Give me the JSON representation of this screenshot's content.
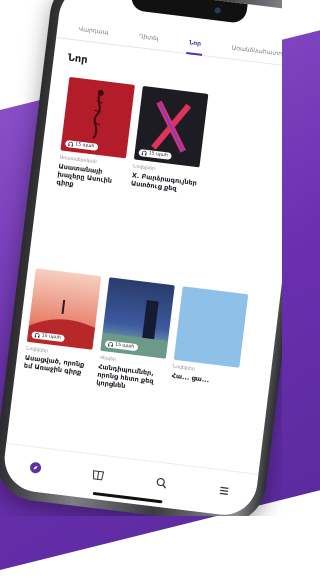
{
  "tabs": [
    {
      "label": "Վարդապ"
    },
    {
      "label": "Դիտել"
    },
    {
      "label": "Նոր"
    },
    {
      "label": "Առանձնահատուկ"
    }
  ],
  "active_tab_index": 2,
  "section": {
    "title": "Նոր"
  },
  "cards": [
    {
      "duration": "15 պահ",
      "genre": "Առասպելական",
      "title": "Ասատանայի խաչերը Ասուին գիրք",
      "cover_color": "#b31d2a"
    },
    {
      "duration": "15 պահ",
      "genre": "Նովելներ",
      "title": "X. Բարձրագույներ Աստծուց քեզ",
      "cover_color": "#1c1c22"
    },
    {
      "duration": "15 պահ",
      "genre": "Նովելներ",
      "title": "Ասացված, որոնք եմ Առաջին գիրք",
      "cover_color": "#f2b7a6"
    },
    {
      "duration": "15 պահ",
      "genre": "Վեպեր",
      "title": "Հանդիպումներ, որոնց հետո քեզ կորցնեն",
      "cover_color": "#2a3b6a"
    },
    {
      "genre": "Նովելներ",
      "title": "Հա... ցա...",
      "cover_color": "#8ec0e8"
    }
  ],
  "nav": [
    {
      "icon": "compass-icon",
      "active": true
    },
    {
      "icon": "book-icon"
    },
    {
      "icon": "search-icon"
    },
    {
      "icon": "menu-icon"
    }
  ],
  "colors": {
    "accent": "#5b2fa8",
    "background": "#6a2fae"
  }
}
